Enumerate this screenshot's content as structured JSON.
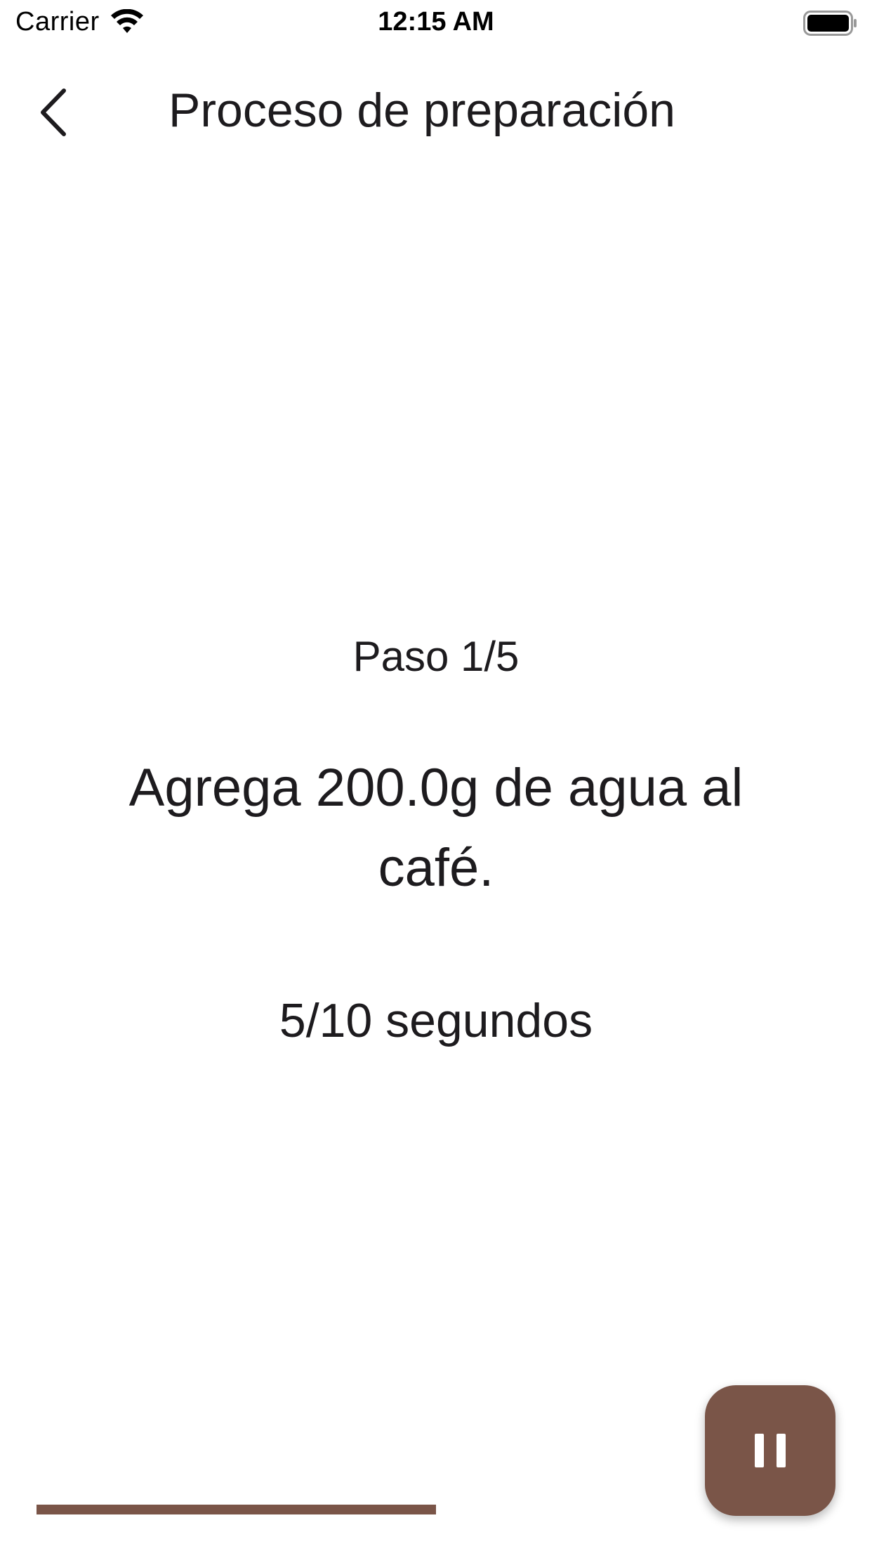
{
  "status_bar": {
    "carrier": "Carrier",
    "time": "12:15 AM",
    "wifi_icon": "wifi-icon",
    "battery_icon": "battery-icon"
  },
  "app_bar": {
    "back_icon": "chevron-left-icon",
    "title": "Proceso de preparación"
  },
  "step": {
    "label": "Paso 1/5",
    "instruction": "Agrega 200.0g de agua al café.",
    "timer": "5/10 segundos"
  },
  "progress": {
    "fraction": 0.5
  },
  "pause_button": {
    "icon": "pause-icon"
  },
  "colors": {
    "accent": "#7a5548",
    "text": "#1d1b1e",
    "background": "#ffffff"
  }
}
